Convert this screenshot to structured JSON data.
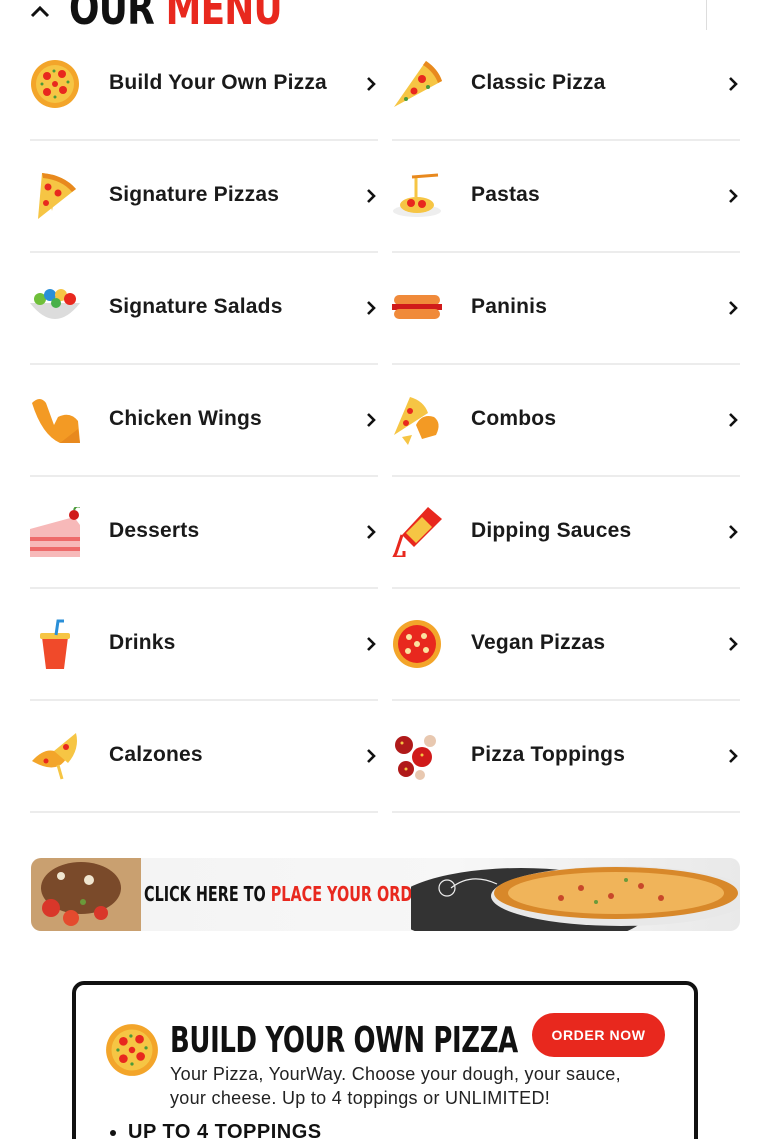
{
  "header": {
    "title_part1": "OUR",
    "title_part2": "MENU"
  },
  "menu": {
    "rows": [
      [
        {
          "label": "Build Your Own Pizza",
          "icon": "pizza-icon"
        },
        {
          "label": "Classic Pizza",
          "icon": "pizza-slice-icon"
        }
      ],
      [
        {
          "label": "Signature Pizzas",
          "icon": "pizza-slice-icon"
        },
        {
          "label": "Pastas",
          "icon": "pasta-icon"
        }
      ],
      [
        {
          "label": "Signature Salads",
          "icon": "salad-bowl-icon"
        },
        {
          "label": "Paninis",
          "icon": "panini-icon"
        }
      ],
      [
        {
          "label": "Chicken Wings",
          "icon": "chicken-wing-icon"
        },
        {
          "label": "Combos",
          "icon": "combo-icon"
        }
      ],
      [
        {
          "label": "Desserts",
          "icon": "cake-icon"
        },
        {
          "label": "Dipping Sauces",
          "icon": "sauce-bottle-icon"
        }
      ],
      [
        {
          "label": "Drinks",
          "icon": "drink-cup-icon"
        },
        {
          "label": "Vegan Pizzas",
          "icon": "vegan-pizza-icon"
        }
      ],
      [
        {
          "label": "Calzones",
          "icon": "calzone-icon"
        },
        {
          "label": "Pizza Toppings",
          "icon": "toppings-icon"
        }
      ]
    ]
  },
  "banner": {
    "text_part1": "CLICK HERE TO",
    "text_part2": "PLACE YOUR ORDER"
  },
  "card": {
    "title": "BUILD YOUR OWN PIZZA",
    "description": "Your Pizza, YourWay. Choose your dough, your sauce, your cheese. Up to 4 toppings or UNLIMITED!",
    "order_button": "ORDER NOW",
    "list": [
      "UP TO 4 TOPPINGS"
    ]
  },
  "colors": {
    "accent": "#e8281e",
    "text": "#111111",
    "divider": "#ececec"
  }
}
